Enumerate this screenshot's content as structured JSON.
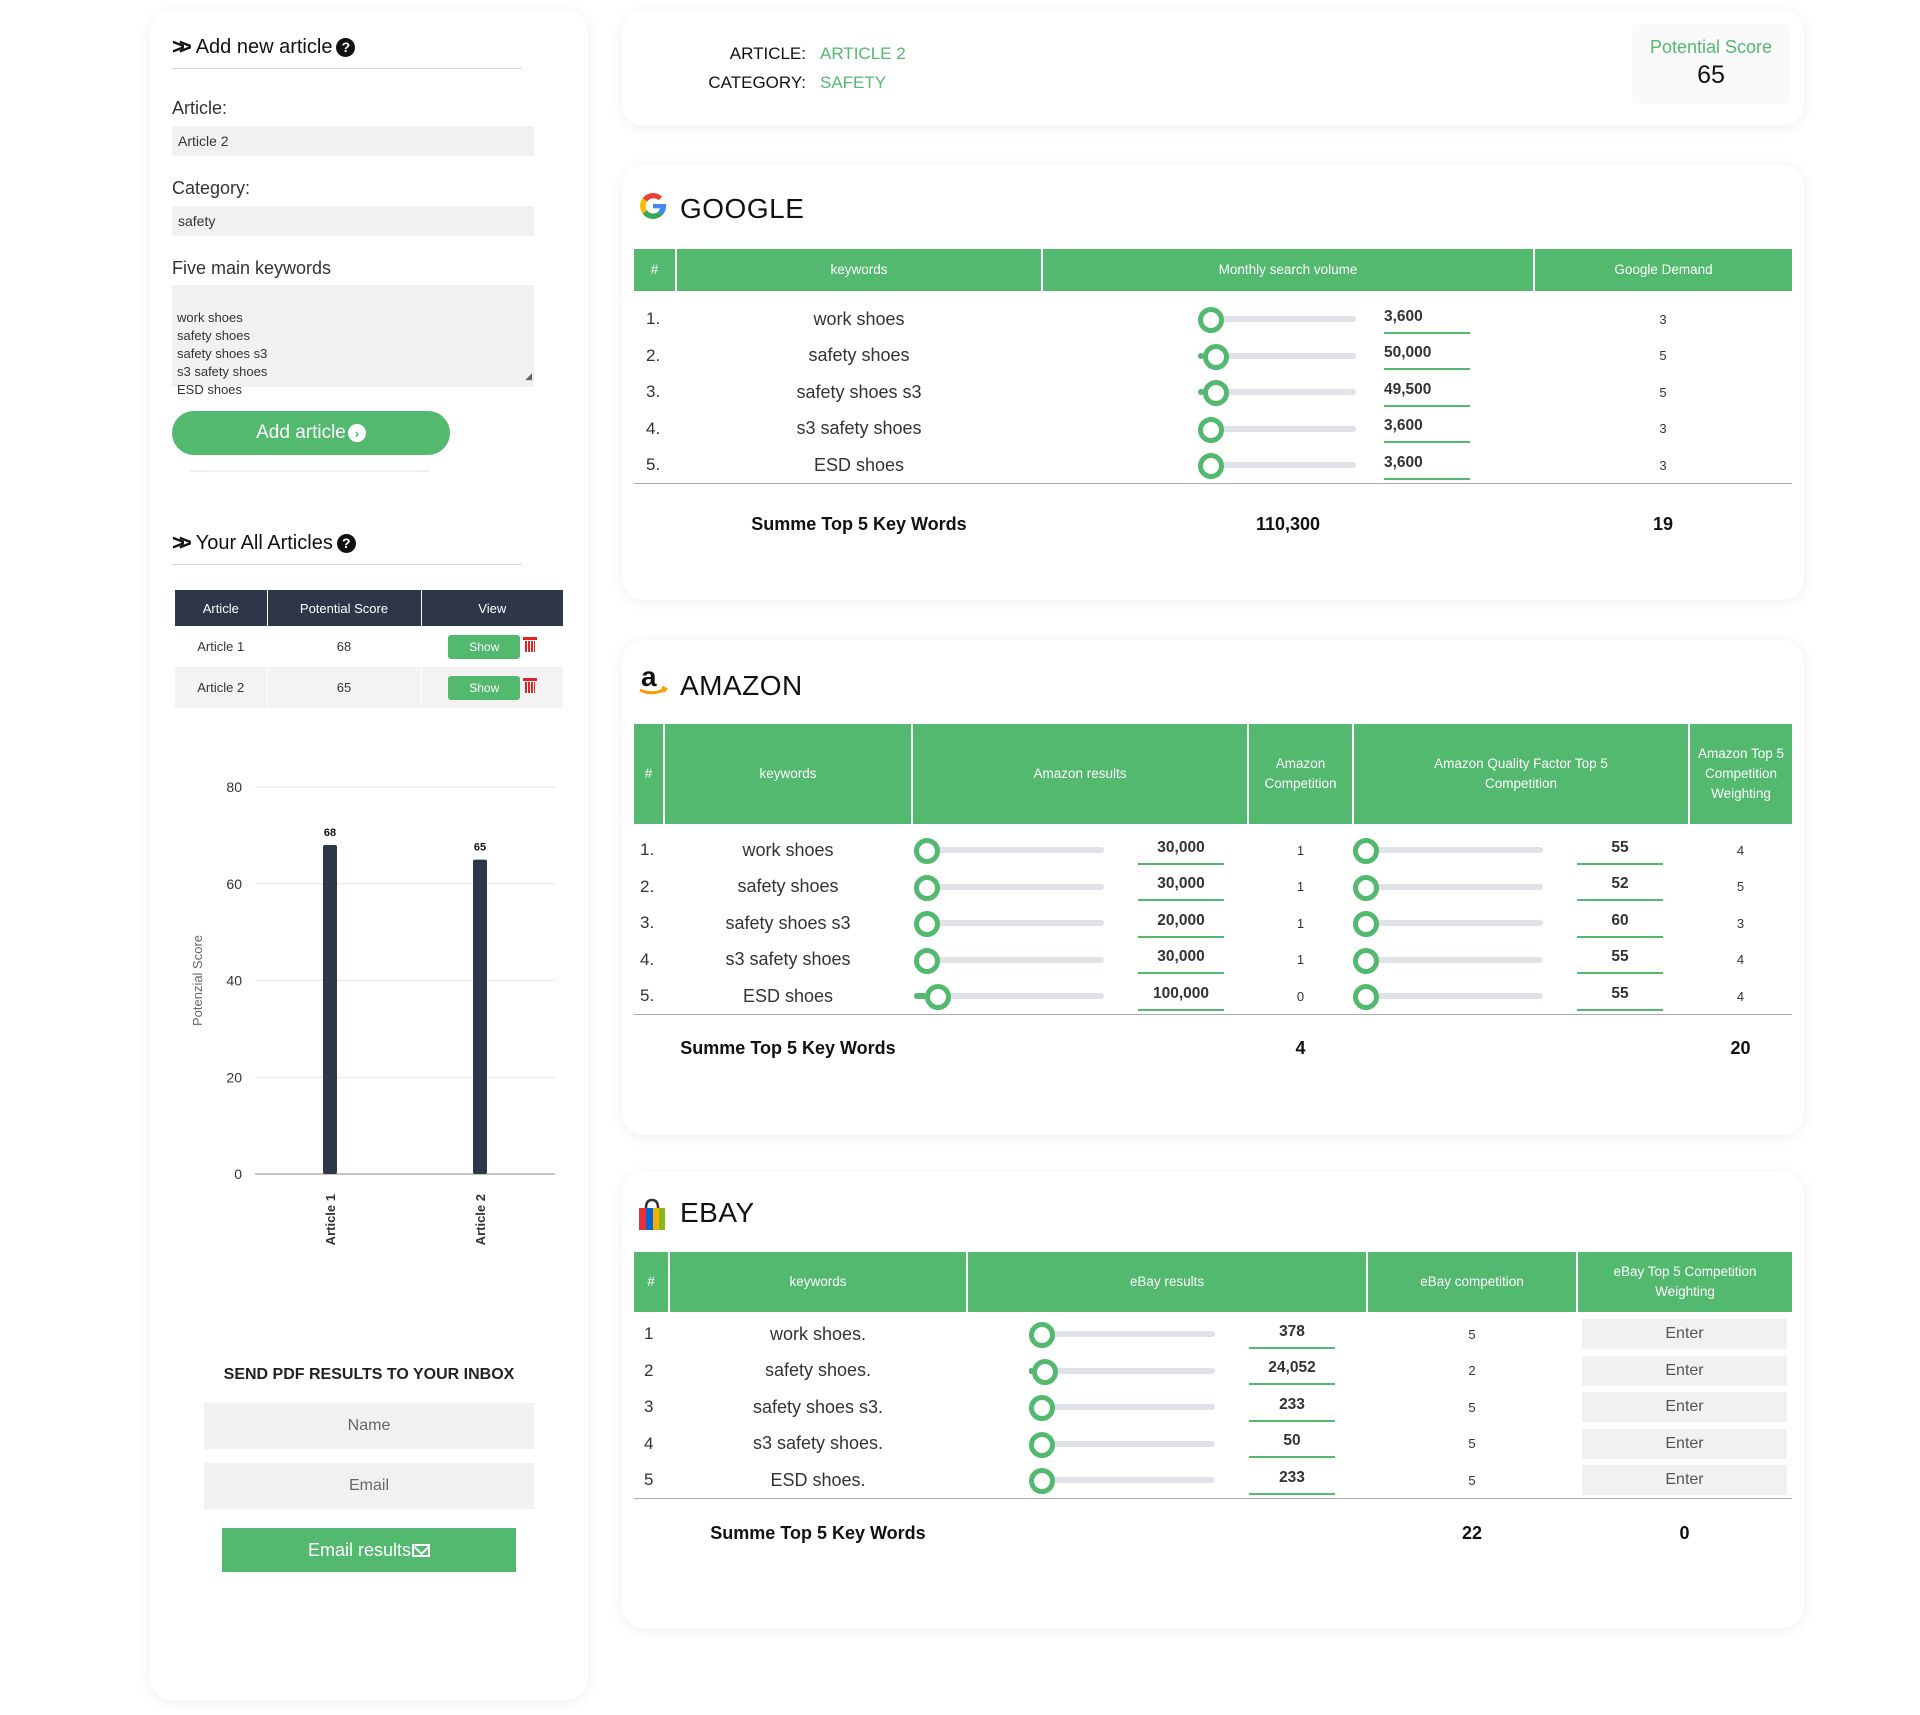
{
  "sidebar": {
    "add_title": "Add new article",
    "article_label": "Article:",
    "article_value": "Article 2",
    "category_label": "Category:",
    "category_value": "safety",
    "keywords_label": "Five main keywords",
    "keywords_value": "work shoes\nsafety shoes\nsafety shoes s3\ns3 safety shoes\nESD shoes",
    "add_button": "Add article",
    "all_title": "Your All Articles",
    "table_headers": [
      "Article",
      "Potential Score",
      "View"
    ],
    "articles": [
      {
        "name": "Article 1",
        "score": "68",
        "view": "Show"
      },
      {
        "name": "Article 2",
        "score": "65",
        "view": "Show"
      }
    ],
    "pdf_title": "SEND PDF RESULTS TO YOUR INBOX",
    "name_placeholder": "Name",
    "email_placeholder": "Email",
    "email_button": "Email results"
  },
  "chart_data": {
    "type": "bar",
    "categories": [
      "Article 1",
      "Article 2"
    ],
    "values": [
      68,
      65
    ],
    "ylabel": "Potenzial Score",
    "ylim": [
      0,
      80
    ],
    "yticks": [
      0,
      20,
      40,
      60,
      80
    ],
    "grid": true,
    "bar_color": "#2d3748"
  },
  "header": {
    "article_key": "ARTICLE:",
    "article_val": "ARTICLE 2",
    "category_key": "CATEGORY:",
    "category_val": "SAFETY",
    "score_label": "Potential Score",
    "score_value": "65"
  },
  "google": {
    "title": "GOOGLE",
    "headers": [
      "#",
      "keywords",
      "Monthly search volume",
      "Google Demand"
    ],
    "rows": [
      {
        "n": "1.",
        "kw": "work shoes",
        "level": 0.0,
        "volume": "3,600",
        "demand": "3"
      },
      {
        "n": "2.",
        "kw": "safety shoes",
        "level": 0.04,
        "volume": "50,000",
        "demand": "5"
      },
      {
        "n": "3.",
        "kw": "safety shoes s3",
        "level": 0.04,
        "volume": "49,500",
        "demand": "5"
      },
      {
        "n": "4.",
        "kw": "s3 safety shoes",
        "level": 0.0,
        "volume": "3,600",
        "demand": "3"
      },
      {
        "n": "5.",
        "kw": "ESD shoes",
        "level": 0.0,
        "volume": "3,600",
        "demand": "3"
      }
    ],
    "sum_label": "Summe Top 5 Key Words",
    "sum_volume": "110,300",
    "sum_demand": "19"
  },
  "amazon": {
    "title": "AMAZON",
    "headers": [
      "#",
      "keywords",
      "Amazon results",
      "Amazon Competition",
      "Amazon Quality Factor Top 5 Competition",
      "Amazon Top 5 Competition Weighting"
    ],
    "rows": [
      {
        "n": "1.",
        "kw": "work shoes",
        "level": 0.0,
        "results": "30,000",
        "comp": "1",
        "qlevel": 0.0,
        "quality": "55",
        "weight": "4"
      },
      {
        "n": "2.",
        "kw": "safety shoes",
        "level": 0.0,
        "results": "30,000",
        "comp": "1",
        "qlevel": 0.0,
        "quality": "52",
        "weight": "5"
      },
      {
        "n": "3.",
        "kw": "safety shoes s3",
        "level": 0.0,
        "results": "20,000",
        "comp": "1",
        "qlevel": 0.0,
        "quality": "60",
        "weight": "3"
      },
      {
        "n": "4.",
        "kw": "s3 safety shoes",
        "level": 0.0,
        "results": "30,000",
        "comp": "1",
        "qlevel": 0.0,
        "quality": "55",
        "weight": "4"
      },
      {
        "n": "5.",
        "kw": "ESD shoes",
        "level": 0.07,
        "results": "100,000",
        "comp": "0",
        "qlevel": 0.0,
        "quality": "55",
        "weight": "4"
      }
    ],
    "sum_label": "Summe Top 5 Key Words",
    "sum_comp": "4",
    "sum_weight": "20"
  },
  "ebay": {
    "title": "EBAY",
    "headers": [
      "#",
      "keywords",
      "eBay results",
      "eBay competition",
      "eBay Top 5 Competition Weighting"
    ],
    "rows": [
      {
        "n": "1",
        "kw": "work shoes.",
        "level": 0.0,
        "results": "378",
        "comp": "5",
        "enter": "Enter"
      },
      {
        "n": "2",
        "kw": "safety shoes.",
        "level": 0.02,
        "results": "24,052",
        "comp": "2",
        "enter": "Enter"
      },
      {
        "n": "3",
        "kw": "safety shoes s3.",
        "level": 0.0,
        "results": "233",
        "comp": "5",
        "enter": "Enter"
      },
      {
        "n": "4",
        "kw": "s3 safety shoes.",
        "level": 0.0,
        "results": "50",
        "comp": "5",
        "enter": "Enter"
      },
      {
        "n": "5",
        "kw": "ESD shoes.",
        "level": 0.0,
        "results": "233",
        "comp": "5",
        "enter": "Enter"
      }
    ],
    "sum_label": "Summe Top 5 Key Words",
    "sum_comp": "22",
    "sum_weight": "0"
  }
}
